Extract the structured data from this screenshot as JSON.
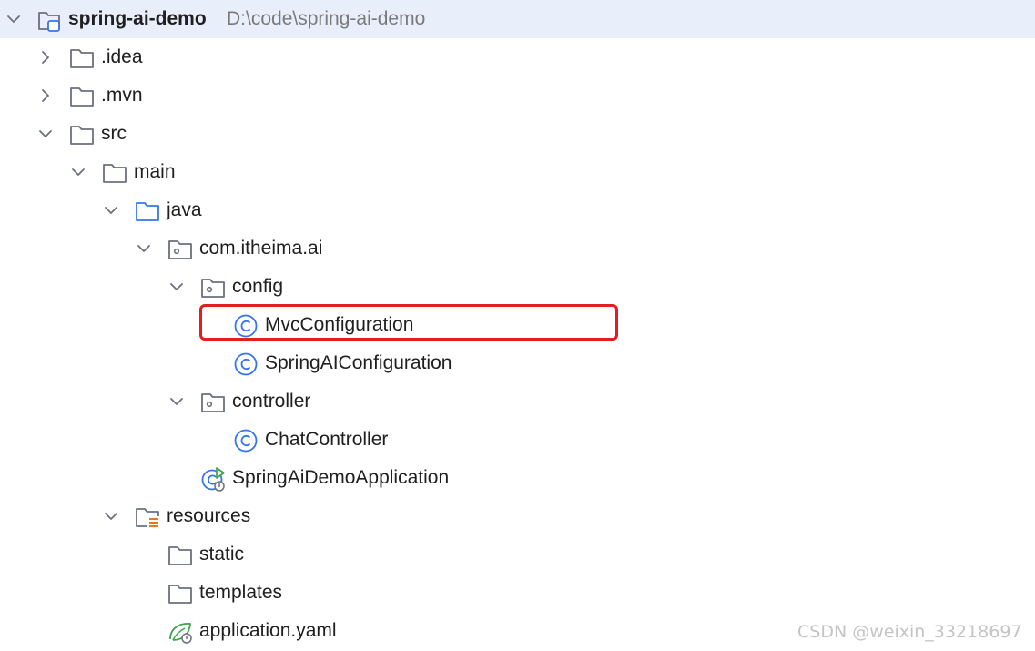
{
  "project": {
    "name": "spring-ai-demo",
    "path": "D:\\code\\spring-ai-demo"
  },
  "tree": {
    "idea": ".idea",
    "mvn": ".mvn",
    "src": "src",
    "main": "main",
    "java": "java",
    "package": "com.itheima.ai",
    "config": "config",
    "mvc_configuration": "MvcConfiguration",
    "springai_configuration": "SpringAIConfiguration",
    "controller": "controller",
    "chat_controller": "ChatController",
    "application_class": "SpringAiDemoApplication",
    "resources": "resources",
    "static": "static",
    "templates": "templates",
    "application_yaml": "application.yaml"
  },
  "icons": {
    "class": "class-icon",
    "folder": "folder-icon",
    "package": "package-icon",
    "source_root": "source-folder-icon",
    "resources_root": "resources-folder-icon",
    "module": "module-icon",
    "spring_app": "spring-boot-application-icon",
    "yaml": "spring-yaml-icon"
  },
  "colors": {
    "selection": "#e9eefb",
    "highlight_border": "#e0201e",
    "class_icon": "#3574f0"
  },
  "watermark": "CSDN @weixin_33218697"
}
